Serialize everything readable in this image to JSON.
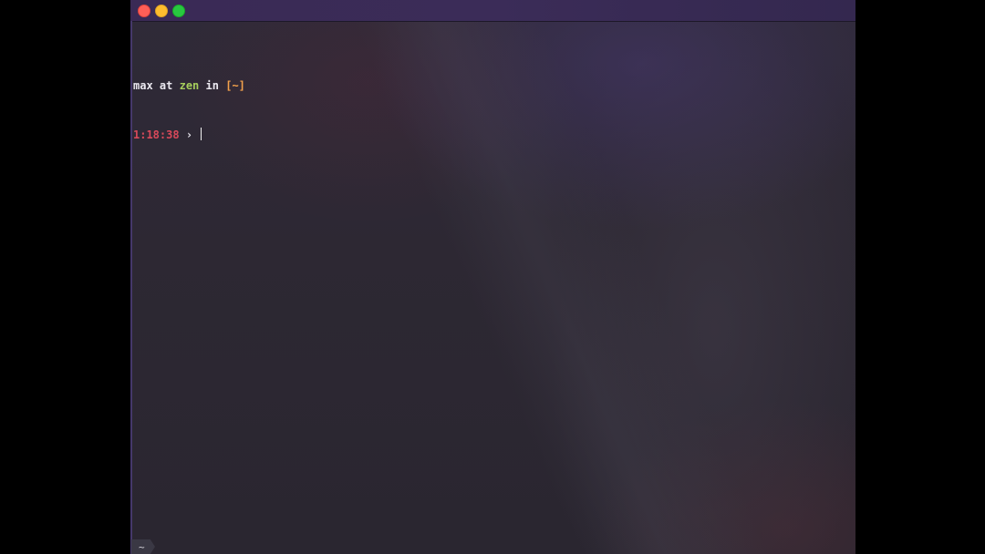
{
  "window": {
    "buttons": {
      "close": "close",
      "minimize": "minimize",
      "zoom": "zoom"
    }
  },
  "terminal": {
    "prompt_line": {
      "user": "max",
      "at": "at",
      "host": "zen",
      "in": "in",
      "directory": "[~]"
    },
    "input_line": {
      "time": "1:18:38",
      "arrow": "›",
      "command": ""
    }
  },
  "statusbar": {
    "tab_label": "~"
  },
  "colors": {
    "user": "#ebe9f0",
    "host": "#a6cf5c",
    "directory": "#f4a24b",
    "time": "#d8495a",
    "titlebar": "#3a2a55",
    "background": "#2d2833"
  }
}
